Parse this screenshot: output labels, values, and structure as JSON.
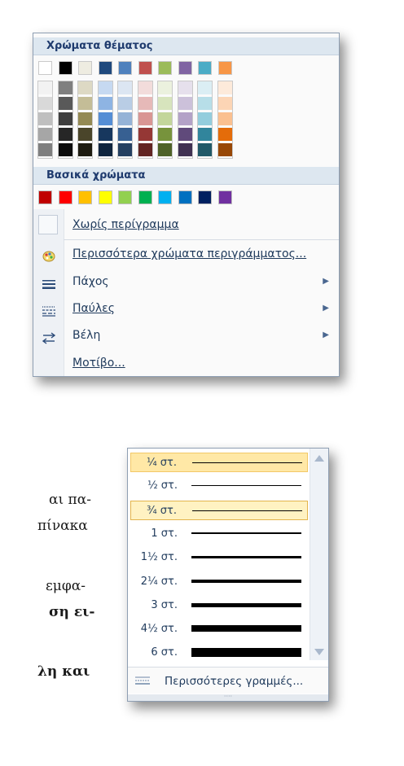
{
  "menu": {
    "theme_header": "Χρώματα θέματος",
    "standard_header": "Βασικά χρώματα",
    "theme_colors": [
      {
        "base": "#ffffff",
        "shades": [
          "#f2f2f2",
          "#d9d9d9",
          "#bfbfbf",
          "#a6a6a6",
          "#7f7f7f"
        ]
      },
      {
        "base": "#000000",
        "shades": [
          "#7f7f7f",
          "#595959",
          "#3f3f3f",
          "#262626",
          "#0d0d0d"
        ]
      },
      {
        "base": "#eeece1",
        "shades": [
          "#ddd9c4",
          "#c4bd97",
          "#948a54",
          "#4a452a",
          "#1e1c11"
        ]
      },
      {
        "base": "#1f497d",
        "shades": [
          "#c6d9f1",
          "#8eb4e3",
          "#558ed5",
          "#17375e",
          "#10253f"
        ]
      },
      {
        "base": "#4f81bd",
        "shades": [
          "#dce6f2",
          "#b9cde5",
          "#95b3d7",
          "#376092",
          "#254061"
        ]
      },
      {
        "base": "#c0504d",
        "shades": [
          "#f2dcdb",
          "#e6b9b8",
          "#d99694",
          "#953735",
          "#632523"
        ]
      },
      {
        "base": "#9bbb59",
        "shades": [
          "#ebf1de",
          "#d7e4bd",
          "#c3d69b",
          "#77933c",
          "#4f6228"
        ]
      },
      {
        "base": "#8064a2",
        "shades": [
          "#e6e0ec",
          "#ccc1da",
          "#b3a2c7",
          "#604a7b",
          "#403152"
        ]
      },
      {
        "base": "#4bacc6",
        "shades": [
          "#dbeef4",
          "#b7dee8",
          "#93cddd",
          "#31859c",
          "#215968"
        ]
      },
      {
        "base": "#f79646",
        "shades": [
          "#fdeada",
          "#fcd5b5",
          "#fac090",
          "#e46c0a",
          "#984807"
        ]
      }
    ],
    "standard_colors": [
      "#c00000",
      "#ff0000",
      "#ffc000",
      "#ffff00",
      "#92d050",
      "#00b050",
      "#00b0f0",
      "#0070c0",
      "#002060",
      "#7030a0"
    ],
    "no_outline": {
      "label": "Χωρίς περίγραμμα"
    },
    "items": [
      {
        "label": "Περισσότερα χρώματα περιγράμματος...",
        "icon": "palette-icon",
        "submenu": false
      },
      {
        "label": "Πάχος",
        "icon": "line-weight-icon",
        "submenu": true
      },
      {
        "label": "Παύλες",
        "icon": "dashes-icon",
        "submenu": true
      },
      {
        "label": "Βέλη",
        "icon": "arrows-icon",
        "submenu": true
      },
      {
        "label": "Μοτίβο...",
        "icon": "",
        "submenu": false
      }
    ]
  },
  "background_text": [
    {
      "text": "αι πα-"
    },
    {
      "text": "πίνακα"
    },
    {
      "text": "εμφα-"
    },
    {
      "text": "ση ει-"
    },
    {
      "text": "λη και"
    }
  ],
  "weights": {
    "rows": [
      {
        "label": "¼ στ.",
        "weight": 0.25,
        "state": "hover"
      },
      {
        "label": "½ στ.",
        "weight": 0.5,
        "state": ""
      },
      {
        "label": "¾ στ.",
        "weight": 0.75,
        "state": "selected"
      },
      {
        "label": "1 στ.",
        "weight": 1,
        "state": ""
      },
      {
        "label": "1½ στ.",
        "weight": 1.5,
        "state": ""
      },
      {
        "label": "2¼ στ.",
        "weight": 2.25,
        "state": ""
      },
      {
        "label": "3 στ.",
        "weight": 3,
        "state": ""
      },
      {
        "label": "4½ στ.",
        "weight": 4.5,
        "state": ""
      },
      {
        "label": "6 στ.",
        "weight": 6,
        "state": ""
      }
    ],
    "more_lines": "Περισσότερες γραμμές..."
  }
}
